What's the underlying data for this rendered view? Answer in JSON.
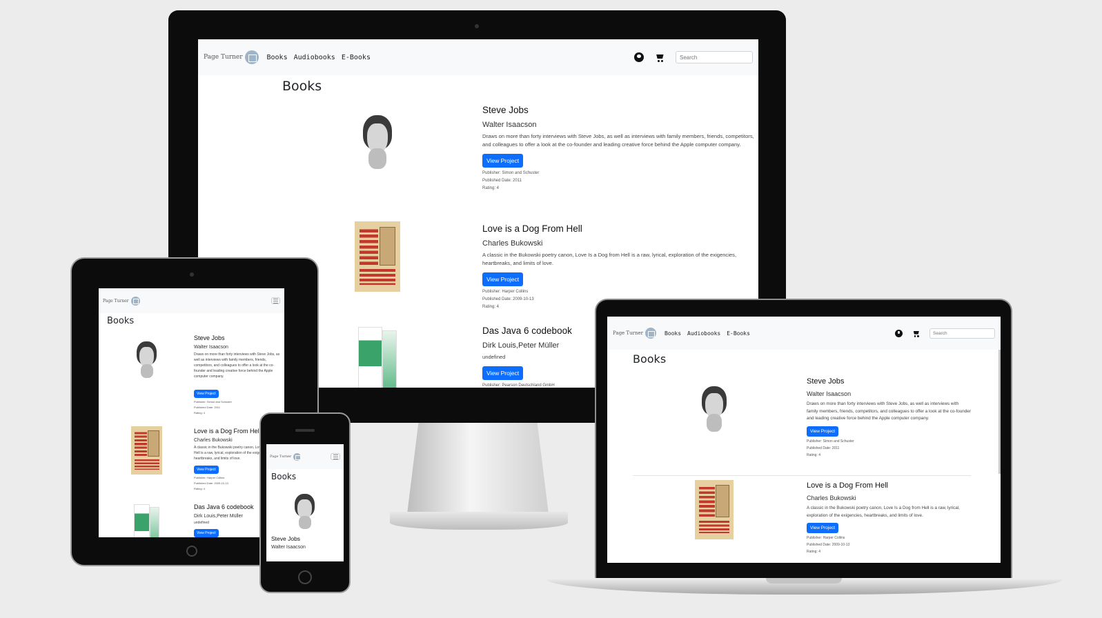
{
  "brand": {
    "name": "Page Turner"
  },
  "nav": {
    "books": "Books",
    "audiobooks": "Audiobooks",
    "ebooks": "E-Books",
    "search_placeholder": "Search"
  },
  "page": {
    "title": "Books"
  },
  "view_label": "View Project",
  "books": [
    {
      "title": "Steve Jobs",
      "author": "Walter Isaacson",
      "description": "Draws on more than forty interviews with Steve Jobs, as well as interviews with family members, friends, competitors, and colleagues to offer a look at the co-founder and leading creative force behind the Apple computer company.",
      "publisher": "Publisher: Simon and Schuster",
      "published": "Published Date: 2011",
      "rating": "Rating: 4"
    },
    {
      "title": "Love is a Dog From Hell",
      "author": "Charles Bukowski",
      "description": "A classic in the Bukowski poetry canon, Love Is a Dog from Hell is a raw, lyrical, exploration of the exigencies, heartbreaks, and limits of love.",
      "publisher": "Publisher: Harper Collins",
      "published": "Published Date: 2009-10-13",
      "rating": "Rating: 4"
    },
    {
      "title": "Das Java 6 codebook",
      "author": "Dirk Louis,Peter Müller",
      "description": "undefined",
      "publisher": "Publisher: Pearson Deutschland GmbH",
      "published": "",
      "rating": ""
    }
  ],
  "colors": {
    "primary_button": "#0d6efd",
    "navbar_bg": "#f8f9fa",
    "background": "#ececec",
    "bezel": "#0c0c0c"
  }
}
